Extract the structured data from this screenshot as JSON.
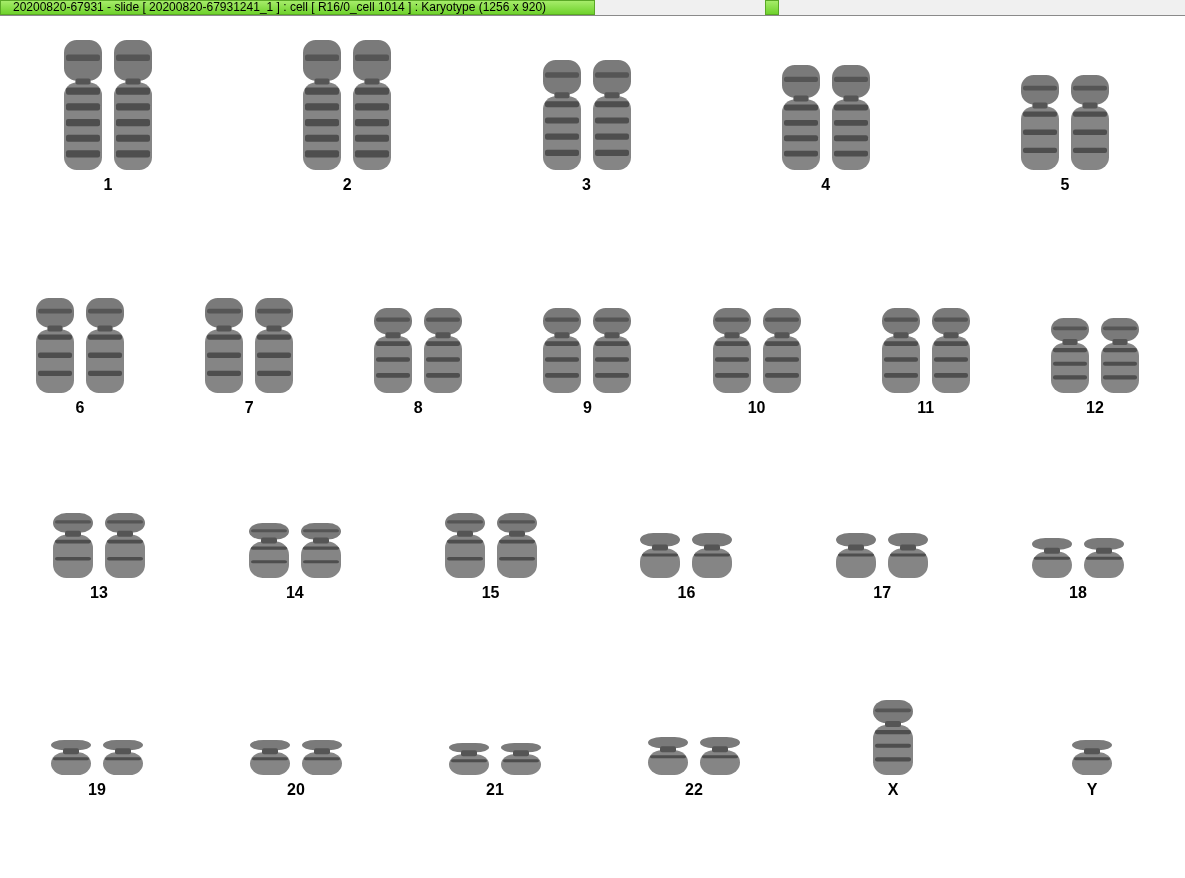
{
  "window": {
    "title": "20200820-67931 - slide [  20200820-67931241_1 ] : cell [ R16/0_cell 1014 ] : Karyotype  (1256 x 920)"
  },
  "karyotype": {
    "rows": [
      {
        "chromosomes": [
          {
            "label": "1",
            "kind": "pair"
          },
          {
            "label": "2",
            "kind": "pair"
          },
          {
            "label": "3",
            "kind": "pair"
          },
          {
            "label": "4",
            "kind": "pair"
          },
          {
            "label": "5",
            "kind": "pair"
          }
        ]
      },
      {
        "chromosomes": [
          {
            "label": "6",
            "kind": "pair"
          },
          {
            "label": "7",
            "kind": "pair"
          },
          {
            "label": "8",
            "kind": "pair"
          },
          {
            "label": "9",
            "kind": "pair"
          },
          {
            "label": "10",
            "kind": "pair"
          },
          {
            "label": "11",
            "kind": "pair"
          },
          {
            "label": "12",
            "kind": "pair"
          }
        ]
      },
      {
        "chromosomes": [
          {
            "label": "13",
            "kind": "pair"
          },
          {
            "label": "14",
            "kind": "pair"
          },
          {
            "label": "15",
            "kind": "pair"
          },
          {
            "label": "16",
            "kind": "pair"
          },
          {
            "label": "17",
            "kind": "pair"
          },
          {
            "label": "18",
            "kind": "pair"
          }
        ]
      },
      {
        "chromosomes": [
          {
            "label": "19",
            "kind": "pair"
          },
          {
            "label": "20",
            "kind": "pair"
          },
          {
            "label": "21",
            "kind": "pair"
          },
          {
            "label": "22",
            "kind": "pair"
          },
          {
            "label": "X",
            "kind": "single"
          },
          {
            "label": "Y",
            "kind": "single"
          }
        ]
      }
    ]
  }
}
